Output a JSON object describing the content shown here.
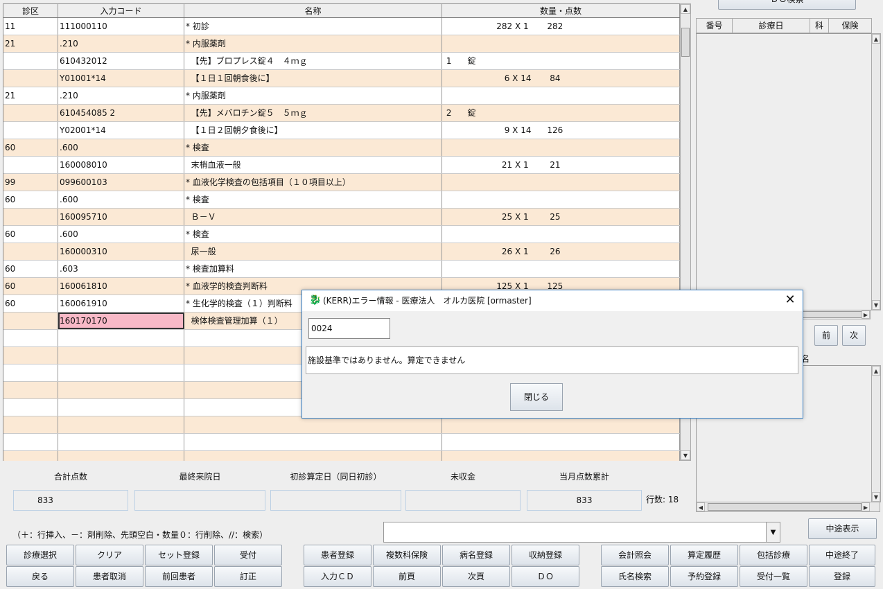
{
  "table": {
    "headers": [
      "診区",
      "入力コード",
      "名称",
      "数量・点数"
    ],
    "rows": [
      [
        "11",
        "111000110",
        "* 初診",
        "                    282 X 1       282"
      ],
      [
        "21",
        ".210",
        "* 内服薬剤",
        ""
      ],
      [
        "",
        "610432012",
        "  【先】ブロプレス錠４　４ｍｇ",
        " 1      錠"
      ],
      [
        "",
        "Y01001*14",
        "  【１日１回朝食後に】",
        "                       6 X 14       84"
      ],
      [
        "21",
        ".210",
        "* 内服薬剤",
        ""
      ],
      [
        "",
        "610454085 2",
        "  【先】メバロチン錠５　５ｍｇ",
        " 2      錠"
      ],
      [
        "",
        "Y02001*14",
        "  【１日２回朝夕食後に】",
        "                       9 X 14      126"
      ],
      [
        "60",
        ".600",
        "* 検査",
        ""
      ],
      [
        "",
        "160008010",
        "  末梢血液一般",
        "                      21 X 1        21"
      ],
      [
        "99",
        "099600103",
        "* 血液化学検査の包括項目（１０項目以上）",
        ""
      ],
      [
        "60",
        ".600",
        "* 検査",
        ""
      ],
      [
        "",
        "160095710",
        "  Ｂ－Ｖ",
        "                      25 X 1        25"
      ],
      [
        "60",
        ".600",
        "* 検査",
        ""
      ],
      [
        "",
        "160000310",
        "  尿一般",
        "                      26 X 1        26"
      ],
      [
        "60",
        ".603",
        "* 検査加算料",
        ""
      ],
      [
        "60",
        "160061810",
        "* 血液学的検査判断料",
        "                    125 X 1       125"
      ],
      [
        "60",
        "160061910",
        "* 生化学的検査（１）判断料",
        ""
      ],
      [
        "",
        "160170170",
        "  検体検査管理加算（１）",
        ""
      ],
      [
        "",
        "",
        "",
        ""
      ],
      [
        "",
        "",
        "",
        ""
      ],
      [
        "",
        "",
        "",
        ""
      ],
      [
        "",
        "",
        "",
        ""
      ],
      [
        "",
        "",
        "",
        ""
      ],
      [
        "",
        "",
        "",
        ""
      ],
      [
        "",
        "",
        "",
        ""
      ],
      [
        "",
        "",
        "",
        ""
      ],
      [
        "",
        "",
        "",
        ""
      ]
    ]
  },
  "right": {
    "do_search": "ＤＯ検索",
    "headers": [
      "番号",
      "診療日",
      "科",
      "保険"
    ],
    "prev": "前",
    "next": "次",
    "disease_fragment": "名"
  },
  "summary": {
    "labels": [
      "合計点数",
      "最終来院日",
      "初診算定日（同日初診）",
      "未収金",
      "当月点数累計"
    ],
    "values": [
      "833",
      "",
      "",
      "",
      "833"
    ],
    "row_count": "行数: 18"
  },
  "hint": "（＋：行挿入、－：剤削除、先頭空白・数量０：行削除、//：検索）",
  "midway_button": "中途表示",
  "buttons": {
    "r1": [
      "診療選択",
      "クリア",
      "セット登録",
      "受付",
      "患者登録",
      "複数科保険",
      "病名登録",
      "収納登録",
      "会計照会",
      "算定履歴",
      "包括診療",
      "中途終了"
    ],
    "r2": [
      "戻る",
      "患者取消",
      "前回患者",
      "訂正",
      "入力ＣＤ",
      "前頁",
      "次頁",
      "ＤＯ",
      "氏名検索",
      "予約登録",
      "受付一覧",
      "登録"
    ]
  },
  "dialog": {
    "title": "(KERR)エラー情報 - 医療法人　オルカ医院  [ormaster]",
    "code": "0024",
    "message": "施設基準ではありません。算定できません",
    "close_button": "閉じる"
  },
  "colors": {
    "row_alt": "#fbe9d5",
    "error_cell": "#f8b9c7",
    "dialog_border": "#3b82c6"
  }
}
